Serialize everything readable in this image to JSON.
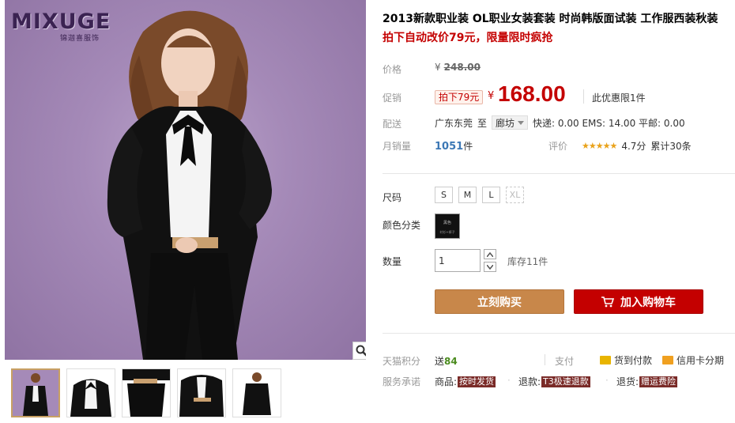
{
  "product": {
    "title": "2013新款职业装 OL职业女装套装 时尚韩版面试装 工作服西装秋装",
    "subtitle": "拍下自动改价79元，限量限时疯抢",
    "brand_logo": "MIXUGE",
    "brand_logo_sub": "锦迦喜服饰"
  },
  "price": {
    "label": "价格",
    "currency": "¥",
    "original": "248.00"
  },
  "promo": {
    "label": "促销",
    "tag": "拍下79元",
    "currency": "¥",
    "price": "168.00",
    "limit": "此优惠限1件"
  },
  "shipping": {
    "label": "配送",
    "from": "广东东莞",
    "to_word": "至",
    "destination": "廊坊",
    "fees": "快递: 0.00 EMS: 14.00 平邮: 0.00"
  },
  "sales": {
    "label": "月销量",
    "count": "1051",
    "unit": "件",
    "rating_label": "评价",
    "stars": "★★★★★",
    "score": "4.7分",
    "total": "累计30条"
  },
  "size": {
    "label": "尺码",
    "options": [
      "S",
      "M",
      "L",
      "XL"
    ]
  },
  "color": {
    "label": "颜色分类",
    "swatch_text": "黑色",
    "swatch_sub": "衬衫+裤子"
  },
  "quantity": {
    "label": "数量",
    "value": "1",
    "stock": "库存11件"
  },
  "buttons": {
    "buy_now": "立刻购买",
    "add_to_cart": "加入购物车"
  },
  "points": {
    "label": "天猫积分",
    "prefix": "送",
    "value": "84"
  },
  "payment": {
    "label": "支付",
    "cod": "货到付款",
    "installment": "信用卡分期"
  },
  "services": {
    "label": "服务承诺",
    "goods_label": "商品:",
    "goods_tag": "按时发货",
    "refund_label": "退款:",
    "refund_tag": "T3极速退款",
    "return_label": "退货:",
    "return_tag": "赠运费险"
  },
  "colors": {
    "accent_red": "#c40000",
    "buy_orange": "#c8874a",
    "background_purple": "#a58ab8",
    "link_blue": "#3c78b5"
  }
}
